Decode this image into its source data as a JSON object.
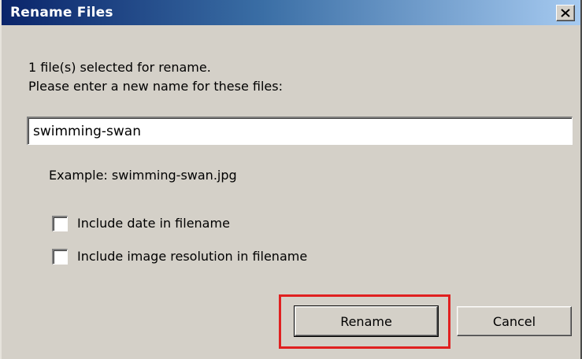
{
  "dialog": {
    "title": "Rename Files",
    "close_icon": "close-icon",
    "selection_info": "1 file(s) selected for rename.",
    "prompt": "Please enter a new name for these files:",
    "filename_value": "swimming-swan",
    "example": "Example: swimming-swan.jpg",
    "options": [
      {
        "label": "Include date in filename",
        "checked": false
      },
      {
        "label": "Include image resolution in filename",
        "checked": false
      }
    ],
    "rename_label": "Rename",
    "cancel_label": "Cancel"
  },
  "colors": {
    "title_gradient_start": "#0a246a",
    "title_gradient_end": "#a6caf0",
    "dialog_bg": "#d4d0c8",
    "highlight": "#e02020"
  }
}
